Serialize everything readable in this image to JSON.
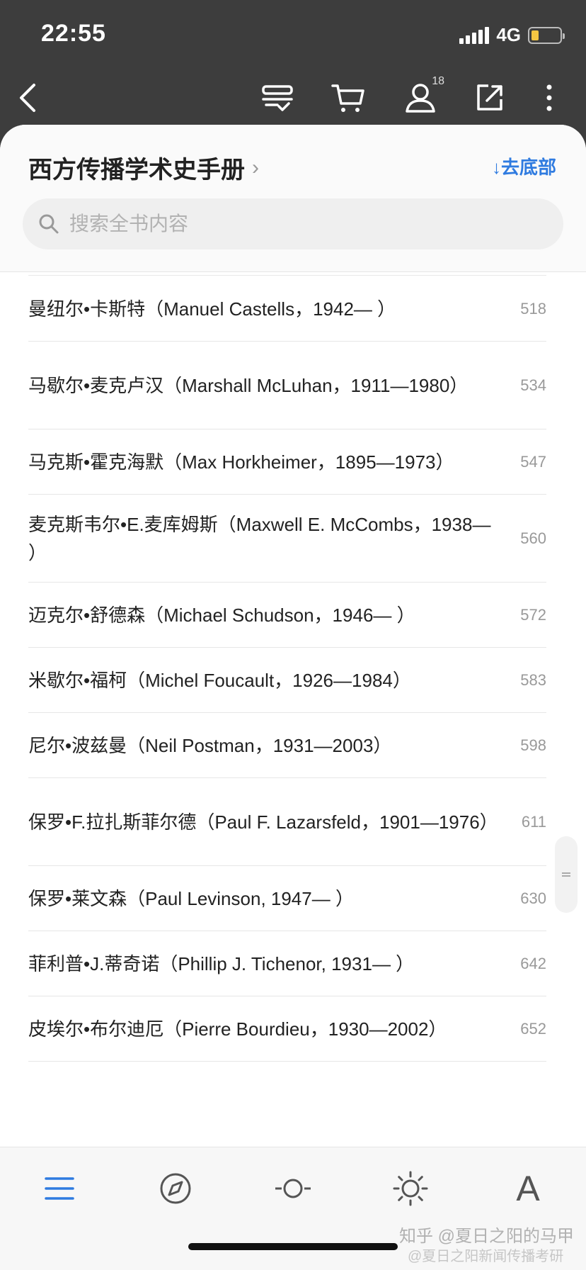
{
  "status_bar": {
    "time": "22:55",
    "network": "4G",
    "battery_level": 0.25,
    "battery_color": "#f5c542"
  },
  "toolbar": {
    "icons": [
      "back-icon",
      "bookshelf-icon",
      "cart-icon",
      "user-icon",
      "share-icon",
      "more-icon"
    ],
    "user_badge": "18"
  },
  "header": {
    "book_title": "西方传播学术史手册",
    "title_chevron": "›",
    "go_bottom": "↓去底部",
    "accent_color": "#2f7be0"
  },
  "search": {
    "placeholder": "搜索全书内容"
  },
  "toc": [
    {
      "title": "曼纽尔•卡斯特（Manuel Castells，1942— ）",
      "page": "518"
    },
    {
      "title": "马歇尔•麦克卢汉（Marshall McLuhan，1911—1980）",
      "page": "534"
    },
    {
      "title": "马克斯•霍克海默（Max Horkheimer，1895—1973）",
      "page": "547"
    },
    {
      "title": "麦克斯韦尔•E.麦库姆斯（Maxwell E. McCombs，1938— ）",
      "page": "560"
    },
    {
      "title": "迈克尔•舒德森（Michael Schudson，1946— ）",
      "page": "572"
    },
    {
      "title": "米歇尔•福柯（Michel Foucault，1926—1984）",
      "page": "583"
    },
    {
      "title": "尼尔•波兹曼（Neil Postman，1931—2003）",
      "page": "598"
    },
    {
      "title": "保罗•F.拉扎斯菲尔德（Paul F. Lazarsfeld，1901—1976）",
      "page": "611"
    },
    {
      "title": "保罗•莱文森（Paul Levinson, 1947— ）",
      "page": "630"
    },
    {
      "title": "菲利普•J.蒂奇诺（Phillip J. Tichenor, 1931— ）",
      "page": "642"
    },
    {
      "title": "皮埃尔•布尔迪厄（Pierre Bourdieu，1930—2002）",
      "page": "652"
    }
  ],
  "bottom_nav": {
    "items": [
      "menu-icon",
      "compass-icon",
      "progress-icon",
      "brightness-icon",
      "font-icon"
    ],
    "font_label": "A",
    "active_color": "#2f7be0"
  },
  "watermark": {
    "line1": "知乎 @夏日之阳的马甲",
    "line2": "@夏日之阳新闻传播考研"
  }
}
